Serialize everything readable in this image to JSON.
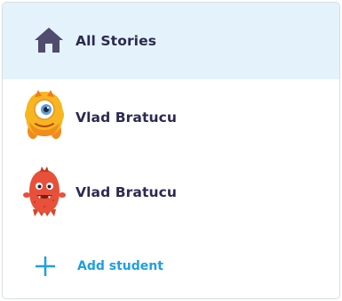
{
  "nav": {
    "all_stories": {
      "label": "All Stories",
      "icon": "home-icon"
    },
    "students": [
      {
        "name": "Vlad Bratucu",
        "avatar": "yellow-one-eyed-monster-avatar"
      },
      {
        "name": "Vlad Bratucu",
        "avatar": "red-furry-monster-avatar"
      }
    ],
    "add_student": {
      "label": "Add student",
      "icon": "plus-icon"
    }
  },
  "colors": {
    "selected_row_bg": "#e4f3fb",
    "text_dark": "#2c2a50",
    "accent_blue": "#1f9ee3",
    "border": "#d9dde3"
  }
}
